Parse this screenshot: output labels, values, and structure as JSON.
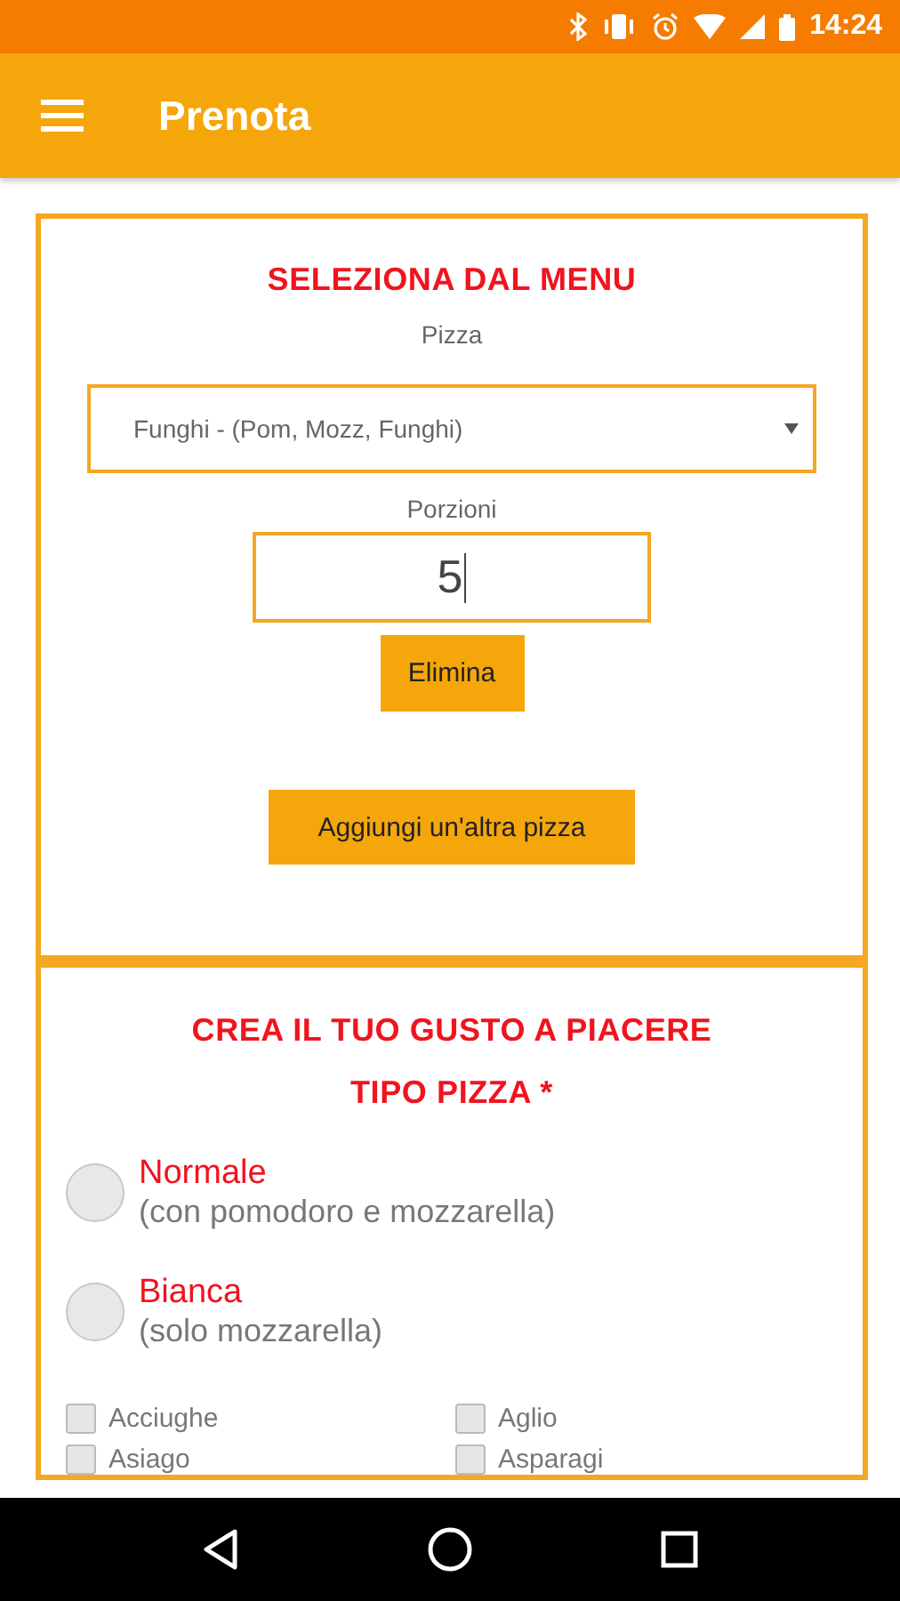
{
  "status_bar": {
    "time": "14:24"
  },
  "app_bar": {
    "title": "Prenota"
  },
  "menu_section": {
    "title": "SELEZIONA DAL MENU",
    "pizza_label": "Pizza",
    "pizza_value": "Funghi - (Pom, Mozz, Funghi)",
    "portions_label": "Porzioni",
    "portions_value": "5",
    "delete_button": "Elimina",
    "add_button": "Aggiungi un'altra pizza"
  },
  "custom_section": {
    "title": "CREA IL TUO GUSTO A PIACERE",
    "type_label": "TIPO PIZZA *",
    "types": [
      {
        "name": "Normale",
        "description": "(con pomodoro e mozzarella)",
        "selected": false
      },
      {
        "name": "Bianca",
        "description": "(solo mozzarella)",
        "selected": false
      }
    ],
    "toppings": [
      {
        "label": "Acciughe",
        "checked": false
      },
      {
        "label": "Aglio",
        "checked": false
      },
      {
        "label": "Asiago",
        "checked": false
      },
      {
        "label": "Asparagi",
        "checked": false
      }
    ]
  }
}
